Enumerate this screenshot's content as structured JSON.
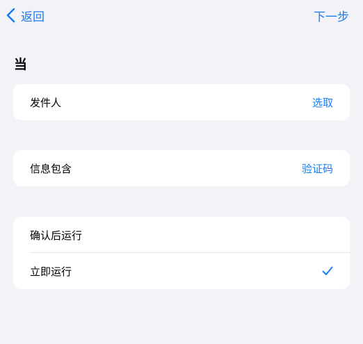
{
  "navbar": {
    "back_label": "返回",
    "next_label": "下一步"
  },
  "section": {
    "title": "当"
  },
  "sender_card": {
    "label": "发件人",
    "value": "选取"
  },
  "message_card": {
    "label": "信息包含",
    "value": "验证码"
  },
  "run_options": {
    "items": [
      {
        "label": "确认后运行",
        "selected": false
      },
      {
        "label": "立即运行",
        "selected": true
      }
    ]
  },
  "colors": {
    "accent": "#1a7cf0",
    "background": "#f2f2f7",
    "card": "#ffffff"
  },
  "icons": {
    "back": "chevron-left-icon",
    "check": "checkmark-icon"
  }
}
